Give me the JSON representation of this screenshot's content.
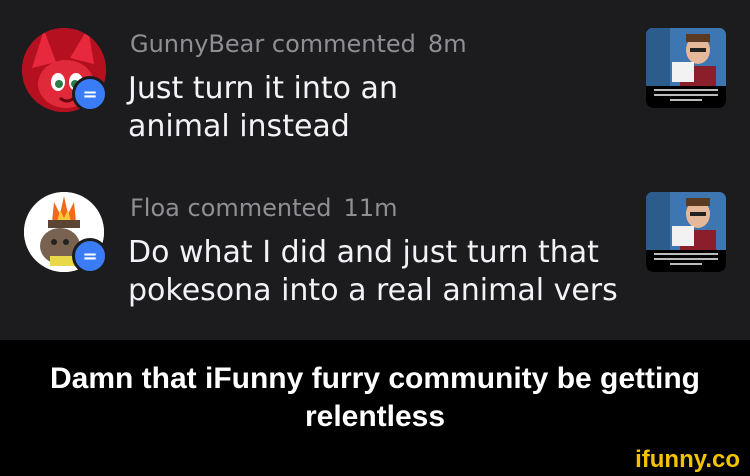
{
  "notifications": [
    {
      "user": "GunnyBear",
      "action": "commented",
      "time": "8m",
      "text_lines": [
        "Just turn it into an",
        "animal instead"
      ]
    },
    {
      "user": "Floa",
      "action": "commented",
      "time": "11m",
      "text_lines": [
        "Do what I did and just turn that",
        "pokesona into a real animal vers"
      ]
    }
  ],
  "badge_icon": "comment-icon",
  "caption": {
    "lines": [
      "Damn that iFunny furry community be getting",
      "relentless"
    ]
  },
  "watermark": "ifunny.co",
  "colors": {
    "background": "#1c1c1e",
    "badge": "#3a7cf6",
    "watermark": "#f4c300"
  }
}
